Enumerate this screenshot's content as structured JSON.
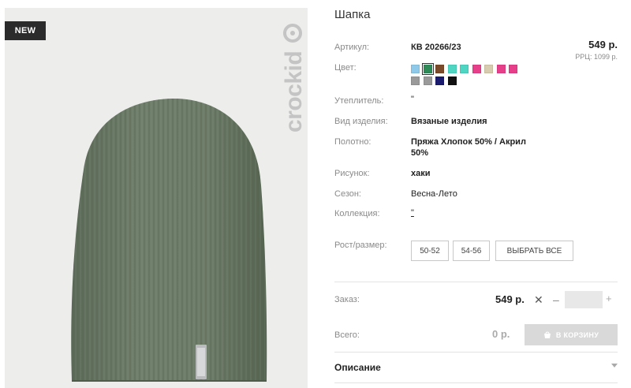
{
  "product": {
    "title": "Шапка",
    "badge": "NEW",
    "brand": "crockid"
  },
  "specs": {
    "article_label": "Артикул:",
    "article_value": "КВ 20266/23",
    "color_label": "Цвет:",
    "insulation_label": "Утеплитель:",
    "insulation_value": "\"",
    "type_label": "Вид изделия:",
    "type_value": "Вязаные изделия",
    "fabric_label": "Полотно:",
    "fabric_line1": "Пряжа Хлопок 50% / Акрил",
    "fabric_line2": "50%",
    "pattern_label": "Рисунок:",
    "pattern_value": "хаки",
    "season_label": "Сезон:",
    "season_value": "Весна-Лето",
    "collection_label": "Коллекция:",
    "collection_value": "\"",
    "size_label": "Рост/размер:"
  },
  "price": {
    "value": "549 р.",
    "rrp": "РРЦ: 1099 р."
  },
  "colors": {
    "row1": [
      "#8ec9ea",
      "#2e8b57",
      "#7b4a2a",
      "#4fd6c3",
      "#4fd6c3",
      "#e83f8a",
      "#d8ccb0",
      "#e83f8a",
      "#e83f8a"
    ],
    "row2": [
      "#9a9a9a",
      "#9a9a9a",
      "#1a1a6e",
      "#111111"
    ],
    "selected_index": 1
  },
  "sizes": {
    "options": [
      "50-52",
      "54-56"
    ],
    "select_all": "ВЫБРАТЬ ВСЕ"
  },
  "order": {
    "label": "Заказ:",
    "price": "549 р.",
    "times": "✕",
    "minus": "–",
    "plus": "+",
    "qty_value": ""
  },
  "total": {
    "label": "Всего:",
    "value": "0 р.",
    "cart_button": "В КОРЗИНУ"
  },
  "description": {
    "label": "Описание"
  }
}
